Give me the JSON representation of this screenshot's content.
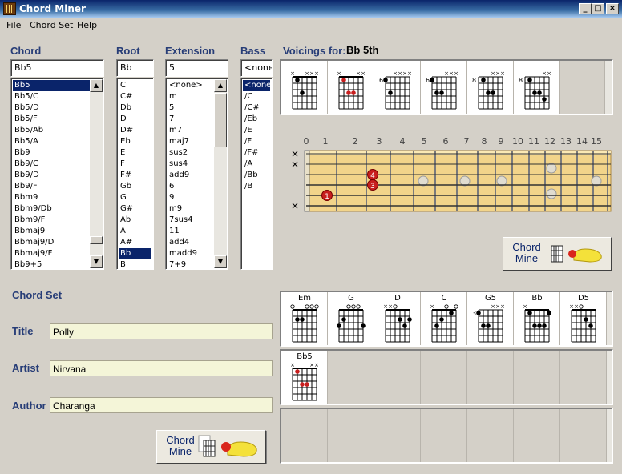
{
  "window": {
    "title": "Chord Miner"
  },
  "menu": [
    "File",
    "Chord Set",
    "Help"
  ],
  "labels": {
    "chord": "Chord",
    "root": "Root",
    "extension": "Extension",
    "bass": "Bass",
    "voicings_for": "Voicings for:",
    "voicing_name": "Bb 5th",
    "chord_set": "Chord Set",
    "title": "Title",
    "artist": "Artist",
    "author": "Author"
  },
  "inputs": {
    "chord": "Bb5",
    "root": "Bb",
    "extension": "5",
    "bass": "<none"
  },
  "chord_list": [
    "Bb5",
    "Bb5/C",
    "Bb5/D",
    "Bb5/F",
    "Bb5/Ab",
    "Bb5/A",
    "Bb9",
    "Bb9/C",
    "Bb9/D",
    "Bb9/F",
    "Bbm9",
    "Bbm9/Db",
    "Bbm9/F",
    "Bbmaj9",
    "Bbmaj9/D",
    "Bbmaj9/F",
    "Bb9+5"
  ],
  "root_list": [
    "C",
    "C#",
    "Db",
    "D",
    "D#",
    "Eb",
    "E",
    "F",
    "F#",
    "Gb",
    "G",
    "G#",
    "Ab",
    "A",
    "A#",
    "Bb",
    "B"
  ],
  "extension_list": [
    "<none>",
    "m",
    "5",
    "7",
    "m7",
    "maj7",
    "sus2",
    "sus4",
    "add9",
    "6",
    "9",
    "m9",
    "7sus4",
    "11",
    "add4",
    "madd9",
    "7+9"
  ],
  "bass_list": [
    "<none>",
    "/C",
    "/C#",
    "/Eb",
    "/E",
    "/F",
    "/F#",
    "/A",
    "/Bb",
    "/B"
  ],
  "voicings": [
    {
      "muted": [
        0,
        3,
        4,
        5
      ],
      "fret": "",
      "dots": [
        [
          1,
          1
        ],
        [
          2,
          3
        ]
      ]
    },
    {
      "muted": [
        0,
        4,
        5
      ],
      "fret": "",
      "dots": [
        [
          1,
          1
        ],
        [
          2,
          3
        ],
        [
          3,
          3
        ]
      ],
      "red": true
    },
    {
      "muted": [
        2,
        3,
        4,
        5
      ],
      "fret": "6",
      "dots": [
        [
          0,
          1
        ],
        [
          1,
          3
        ]
      ]
    },
    {
      "muted": [
        3,
        4,
        5
      ],
      "fret": "6",
      "dots": [
        [
          0,
          1
        ],
        [
          1,
          3
        ],
        [
          2,
          3
        ]
      ]
    },
    {
      "muted": [
        3,
        4,
        5
      ],
      "fret": "8",
      "dots": [
        [
          1,
          1
        ],
        [
          2,
          3
        ],
        [
          3,
          3
        ]
      ]
    },
    {
      "muted": [
        4,
        5
      ],
      "fret": "8",
      "dots": [
        [
          1,
          1
        ],
        [
          2,
          3
        ],
        [
          3,
          3
        ],
        [
          4,
          4
        ]
      ]
    }
  ],
  "fret_numbers": [
    "0",
    "1",
    "2",
    "3",
    "4",
    "5",
    "6",
    "7",
    "8",
    "9",
    "10",
    "11",
    "12",
    "13",
    "14",
    "15"
  ],
  "chord_set_row1": [
    {
      "name": "Em",
      "muted": [],
      "open": [
        0,
        3,
        4,
        5
      ],
      "fret": "",
      "dots": [
        [
          1,
          2
        ],
        [
          2,
          2
        ]
      ]
    },
    {
      "name": "G",
      "muted": [],
      "open": [
        2,
        3,
        4
      ],
      "fret": "",
      "dots": [
        [
          0,
          3
        ],
        [
          1,
          2
        ],
        [
          5,
          3
        ]
      ]
    },
    {
      "name": "D",
      "muted": [
        0,
        1
      ],
      "open": [
        2
      ],
      "fret": "",
      "dots": [
        [
          3,
          2
        ],
        [
          4,
          3
        ],
        [
          5,
          2
        ]
      ]
    },
    {
      "name": "C",
      "muted": [
        0
      ],
      "open": [
        3,
        5
      ],
      "fret": "",
      "dots": [
        [
          1,
          3
        ],
        [
          2,
          2
        ],
        [
          4,
          1
        ]
      ]
    },
    {
      "name": "G5",
      "muted": [
        3,
        4,
        5
      ],
      "open": [],
      "fret": "3",
      "dots": [
        [
          0,
          1
        ],
        [
          1,
          3
        ],
        [
          2,
          3
        ]
      ]
    },
    {
      "name": "Bb",
      "muted": [
        0
      ],
      "open": [],
      "fret": "",
      "dots": [
        [
          1,
          1
        ],
        [
          2,
          3
        ],
        [
          3,
          3
        ],
        [
          4,
          3
        ],
        [
          5,
          1
        ]
      ]
    },
    {
      "name": "D5",
      "muted": [
        0,
        1
      ],
      "open": [
        2
      ],
      "fret": "",
      "dots": [
        [
          3,
          2
        ],
        [
          4,
          3
        ]
      ]
    }
  ],
  "chord_set_row2": [
    {
      "name": "Bb5",
      "muted": [
        0,
        4,
        5
      ],
      "open": [],
      "fret": "",
      "dots": [
        [
          1,
          1
        ],
        [
          2,
          3
        ],
        [
          3,
          3
        ]
      ],
      "red": true
    }
  ],
  "chord_set": {
    "title": "Polly",
    "artist": "Nirvana",
    "author": "Charanga"
  },
  "buttons": {
    "chord_mine": "Chord Mine"
  },
  "fretboard": {
    "markers": [
      {
        "string": 4,
        "fret": 1,
        "label": "1"
      },
      {
        "string": 2,
        "fret": 3,
        "label": "4"
      },
      {
        "string": 3,
        "fret": 3,
        "label": "3"
      }
    ],
    "muted_strings": [
      0,
      1,
      5
    ]
  }
}
